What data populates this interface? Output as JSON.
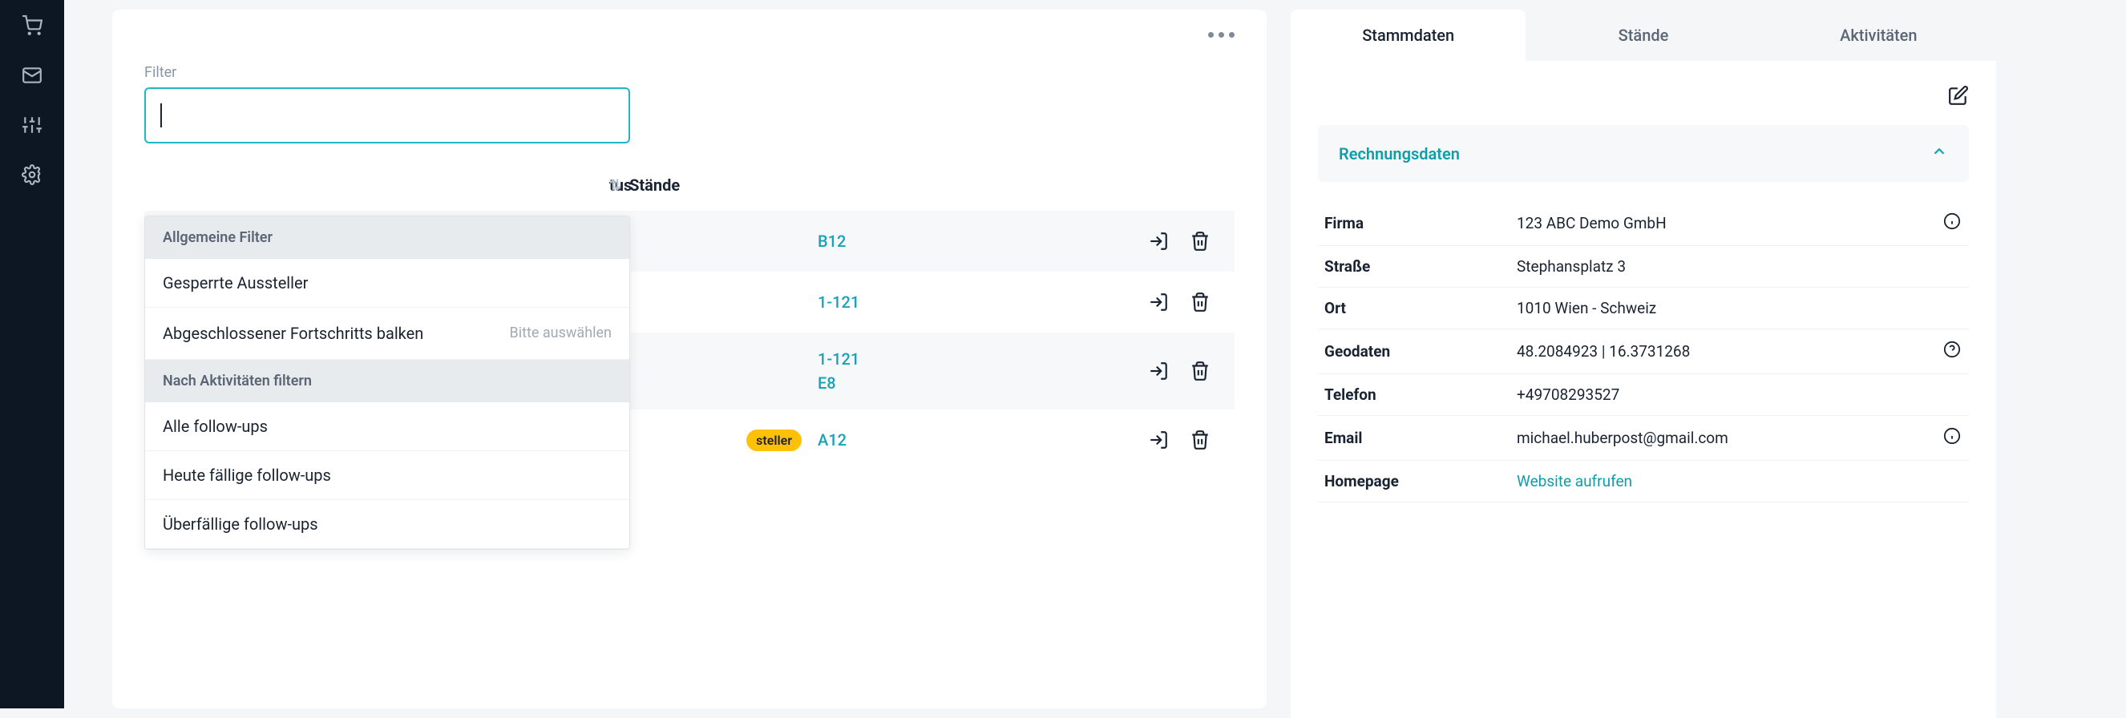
{
  "filter": {
    "label": "Filter",
    "input_value": "",
    "groups": [
      {
        "title": "Allgemeine Filter",
        "items": [
          {
            "label": "Gesperrte Aussteller",
            "hint": ""
          },
          {
            "label": "Abgeschlossener Fortschritts balken",
            "hint": "Bitte auswählen"
          }
        ]
      },
      {
        "title": "Nach Aktivitäten filtern",
        "items": [
          {
            "label": "Alle follow-ups",
            "hint": ""
          },
          {
            "label": "Heute fällige follow-ups",
            "hint": ""
          },
          {
            "label": "Überfällige follow-ups",
            "hint": ""
          }
        ]
      }
    ]
  },
  "table": {
    "columns": {
      "status": "tus",
      "stande": "Stände"
    },
    "rows": [
      {
        "stande": [
          "B12"
        ],
        "badge": ""
      },
      {
        "stande": [
          "1-121"
        ],
        "badge": ""
      },
      {
        "stande": [
          "1-121",
          "E8"
        ],
        "badge": ""
      },
      {
        "stande": [
          "A12"
        ],
        "badge": "steller"
      }
    ]
  },
  "detail": {
    "tabs": [
      {
        "label": "Stammdaten",
        "active": true
      },
      {
        "label": "Stände",
        "active": false
      },
      {
        "label": "Aktivitäten",
        "active": false
      }
    ],
    "section_title": "Rechnungsdaten",
    "fields": [
      {
        "label": "Firma",
        "value": "123 ABC Demo GmbH",
        "icon": "info"
      },
      {
        "label": "Straße",
        "value": "Stephansplatz 3",
        "icon": ""
      },
      {
        "label": "Ort",
        "value": "1010 Wien - Schweiz",
        "icon": ""
      },
      {
        "label": "Geodaten",
        "value": "48.2084923 | 16.3731268",
        "icon": "help"
      },
      {
        "label": "Telefon",
        "value": "+49708293527",
        "icon": ""
      },
      {
        "label": "Email",
        "value": "michael.huberpost@gmail.com",
        "icon": "info"
      },
      {
        "label": "Homepage",
        "value": "Website aufrufen",
        "icon": "",
        "link": true
      }
    ]
  }
}
